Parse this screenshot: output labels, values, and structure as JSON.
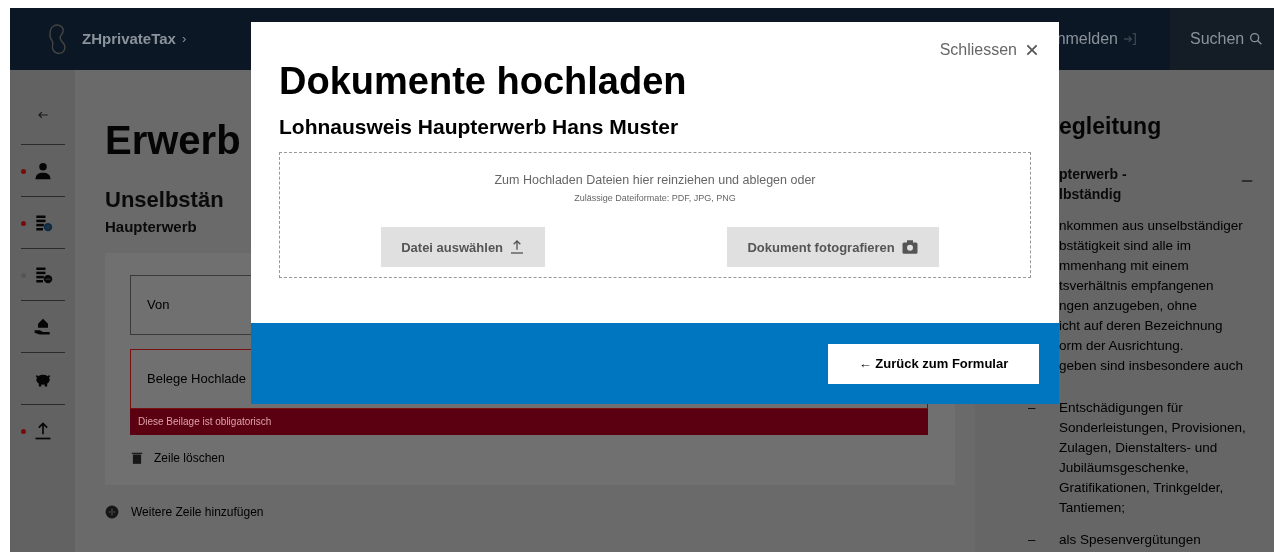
{
  "header": {
    "brand": "ZHprivateTax",
    "separator": "›",
    "login": "nmelden",
    "search": "Suchen"
  },
  "sidebar": {
    "items": [
      {
        "kind": "person",
        "color": "#7a0a0a"
      },
      {
        "kind": "add-coins",
        "color": "#7a0a0a"
      },
      {
        "kind": "remove-coins",
        "color": "#555555"
      },
      {
        "kind": "house-hand"
      },
      {
        "kind": "piggy"
      },
      {
        "kind": "upload",
        "color": "#7a0a0a"
      }
    ]
  },
  "main": {
    "title": "Erwerb",
    "section": "Unselbstän",
    "subsection": "Haupterwerb",
    "fields": [
      {
        "label": "Von",
        "error": false
      },
      {
        "label": "Belege Hochlade",
        "error": true
      }
    ],
    "error_message": "Diese Beilage ist obligatorisch",
    "delete_row": "Zeile löschen",
    "add_row": "Weitere Zeile hinzufügen"
  },
  "panel": {
    "title": "egleitung",
    "accordion": {
      "heading": [
        "pterwerb -",
        "lbständig"
      ],
      "expanded": true,
      "lines": [
        "nkommen aus unselbständiger",
        "bstätigkeit sind alle im",
        "mmenhang mit einem",
        "tsverhältnis empfangenen",
        "ngen anzugeben, ohne",
        "icht auf deren Bezeichnung",
        "orm der Ausrichtung.",
        "geben sind insbesondere auch"
      ],
      "list": [
        {
          "bullet": "–",
          "text": "Entschädigungen für Sonderleistungen, Provisionen, Zulagen, Dienstalters- und Jubiläumsgeschenke, Gratifikationen, Trinkgelder, Tantiemen;"
        },
        {
          "bullet": "–",
          "text": "als Spesenvergütungen"
        }
      ]
    }
  },
  "modal": {
    "close": "Schliessen",
    "title": "Dokumente hochladen",
    "subtitle": "Lohnausweis Haupterwerb Hans Muster",
    "drop_text": "Zum Hochladen Dateien hier reinziehen und ablegen oder",
    "formats": "Zulässige Dateiformate: PDF, JPG, PNG",
    "buttons": [
      {
        "label": "Datei auswählen",
        "kind": "file"
      },
      {
        "label": "Dokument fotografieren",
        "kind": "camera"
      }
    ],
    "back": "← Zurück zum Formular"
  }
}
